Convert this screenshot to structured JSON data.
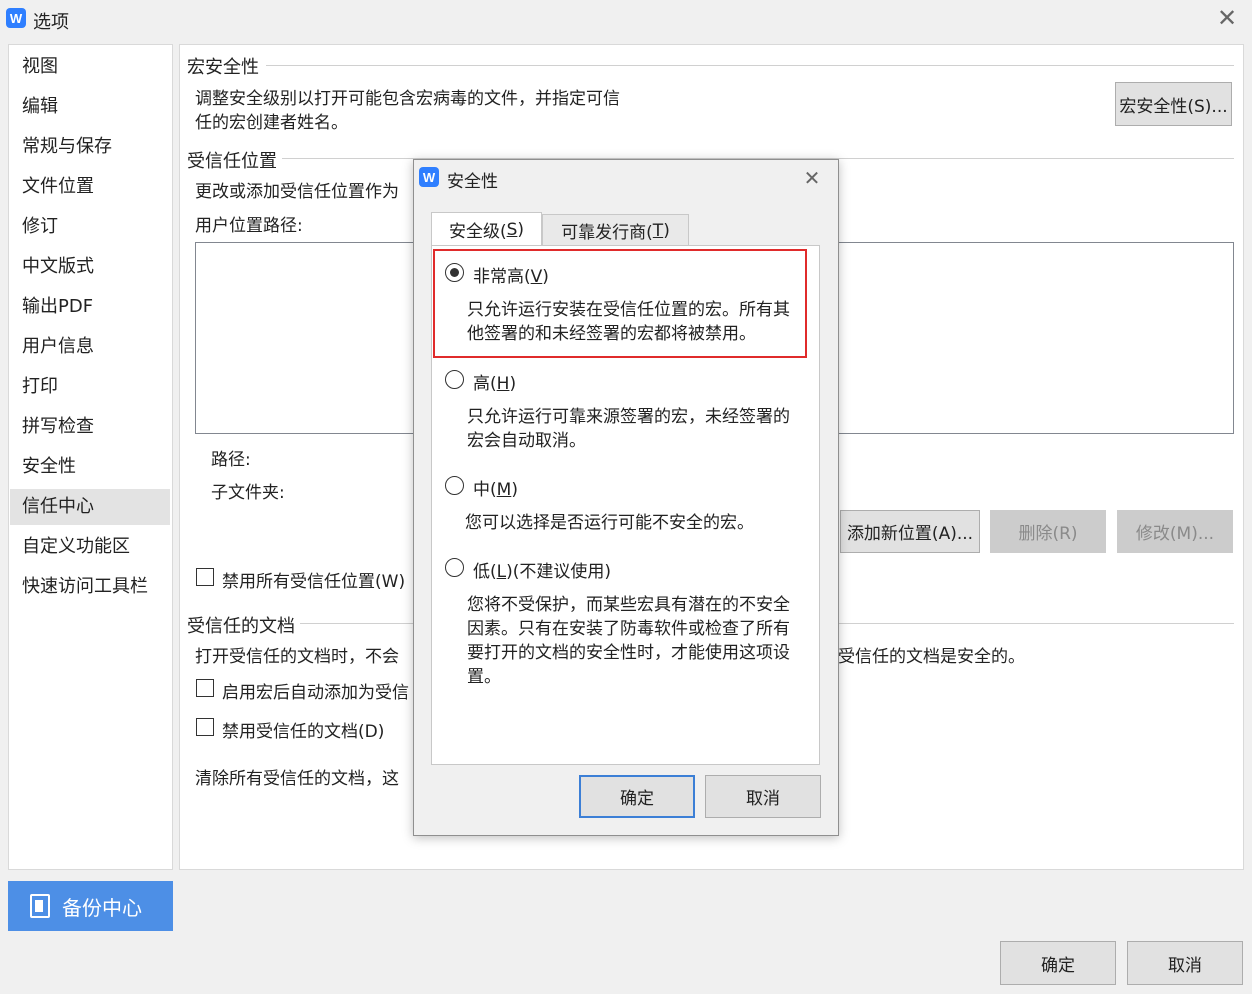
{
  "window": {
    "title": "选项",
    "close_icon": "close-icon"
  },
  "nav": {
    "items": [
      "视图",
      "编辑",
      "常规与保存",
      "文件位置",
      "修订",
      "中文版式",
      "输出PDF",
      "用户信息",
      "打印",
      "拼写检查",
      "安全性",
      "信任中心",
      "自定义功能区",
      "快速访问工具栏"
    ],
    "active_index": 11,
    "backup_label": "备份中心"
  },
  "macro": {
    "title": "宏安全性",
    "desc_line1": "调整安全级别以打开可能包含宏病毒的文件，并指定可信",
    "desc_line2": "任的宏创建者姓名。",
    "button": "宏安全性(S)..."
  },
  "trusted_locations": {
    "title": "受信任位置",
    "desc": "更改或添加受信任位置作为",
    "path_list_label": "用户位置路径:",
    "path_label": "路径:",
    "subfolder_label": "子文件夹:",
    "add_button": "添加新位置(A)...",
    "delete_button": "删除(R)",
    "modify_button": "修改(M)...",
    "disable_all_label": "禁用所有受信任位置(W)"
  },
  "trusted_docs": {
    "title": "受信任的文档",
    "desc_left": "打开受信任的文档时，不会",
    "desc_right": "受信任的文档是安全的。",
    "auto_add_label": "启用宏后自动添加为受信",
    "disable_label": "禁用受信任的文档(D)",
    "clear_text": "清除所有受信任的文档，这"
  },
  "footer": {
    "ok": "确定",
    "cancel": "取消"
  },
  "dialog": {
    "title": "安全性",
    "tabs": [
      {
        "label": "安全级(",
        "key": "S",
        "suffix": ")"
      },
      {
        "label": "可靠发行商(",
        "key": "T",
        "suffix": ")"
      }
    ],
    "options": [
      {
        "label": "非常高(",
        "key": "V",
        "suffix": ")",
        "desc": "只允许运行安装在受信任位置的宏。所有其他签署的和未经签署的宏都将被禁用。",
        "checked": true
      },
      {
        "label": "高(",
        "key": "H",
        "suffix": ")",
        "desc": "只允许运行可靠来源签署的宏，未经签署的宏会自动取消。",
        "checked": false
      },
      {
        "label": "中(",
        "key": "M",
        "suffix": ")",
        "desc": "您可以选择是否运行可能不安全的宏。",
        "checked": false
      },
      {
        "label": "低(",
        "key": "L",
        "suffix": ")(不建议使用)",
        "desc": "您将不受保护，而某些宏具有潜在的不安全因素。只有在安装了防毒软件或检查了所有要打开的文档的安全性时，才能使用这项设置。",
        "checked": false
      }
    ],
    "ok": "确定",
    "cancel": "取消",
    "highlight_color": "#e02b2b"
  },
  "colors": {
    "accent": "#4d8fe6",
    "app_icon": "#2f7fff",
    "default_button_border": "#3c7fd6"
  }
}
